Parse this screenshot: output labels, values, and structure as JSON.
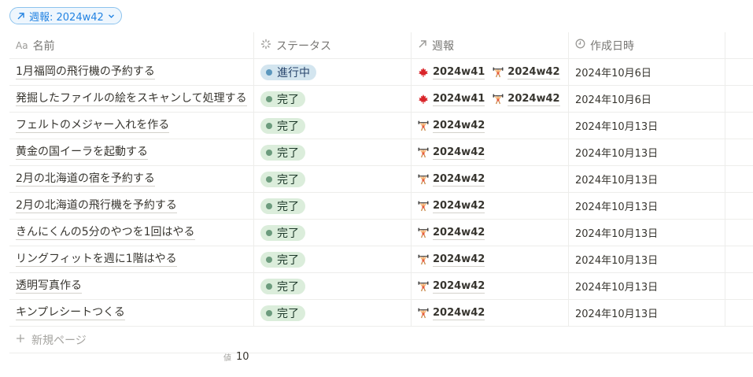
{
  "filter": {
    "label": "週報: 2024w42",
    "icon": "arrow-up-right-icon",
    "chevron": "chevron-down-icon"
  },
  "columns": [
    {
      "label": "名前",
      "icon_text": "Aa"
    },
    {
      "label": "ステータス",
      "icon": "status-loader-icon"
    },
    {
      "label": "週報",
      "icon": "arrow-up-right-icon"
    },
    {
      "label": "作成日時",
      "icon": "clock-icon"
    }
  ],
  "rows": [
    {
      "name": "1月福岡の飛行機の予約する",
      "status": "進行中",
      "status_color": "blue",
      "reports": [
        {
          "label": "2024w41",
          "icon": "maple-leaf-icon"
        },
        {
          "label": "2024w42",
          "icon": "weightlifter-icon"
        },
        {
          "label": "",
          "icon": "ship-icon"
        }
      ],
      "date": "2024年10月6日"
    },
    {
      "name": "発掘したファイルの絵をスキャンして処理する",
      "status": "完了",
      "status_color": "green",
      "reports": [
        {
          "label": "2024w41",
          "icon": "maple-leaf-icon"
        },
        {
          "label": "2024w42",
          "icon": "weightlifter-icon"
        }
      ],
      "date": "2024年10月6日"
    },
    {
      "name": "フェルトのメジャー入れを作る",
      "status": "完了",
      "status_color": "green",
      "reports": [
        {
          "label": "2024w42",
          "icon": "weightlifter-icon"
        }
      ],
      "date": "2024年10月13日"
    },
    {
      "name": "黄金の国イーラを起動する",
      "status": "完了",
      "status_color": "green",
      "reports": [
        {
          "label": "2024w42",
          "icon": "weightlifter-icon"
        }
      ],
      "date": "2024年10月13日"
    },
    {
      "name": "2月の北海道の宿を予約する",
      "status": "完了",
      "status_color": "green",
      "reports": [
        {
          "label": "2024w42",
          "icon": "weightlifter-icon"
        }
      ],
      "date": "2024年10月13日"
    },
    {
      "name": "2月の北海道の飛行機を予約する",
      "status": "完了",
      "status_color": "green",
      "reports": [
        {
          "label": "2024w42",
          "icon": "weightlifter-icon"
        }
      ],
      "date": "2024年10月13日"
    },
    {
      "name": "きんにくんの5分のやつを1回はやる",
      "status": "完了",
      "status_color": "green",
      "reports": [
        {
          "label": "2024w42",
          "icon": "weightlifter-icon"
        }
      ],
      "date": "2024年10月13日"
    },
    {
      "name": "リングフィットを週に1階はやる",
      "status": "完了",
      "status_color": "green",
      "reports": [
        {
          "label": "2024w42",
          "icon": "weightlifter-icon"
        }
      ],
      "date": "2024年10月13日"
    },
    {
      "name": "透明写真作る",
      "status": "完了",
      "status_color": "green",
      "reports": [
        {
          "label": "2024w42",
          "icon": "weightlifter-icon"
        }
      ],
      "date": "2024年10月13日"
    },
    {
      "name": "キンプレシートつくる",
      "status": "完了",
      "status_color": "green",
      "reports": [
        {
          "label": "2024w42",
          "icon": "weightlifter-icon"
        }
      ],
      "date": "2024年10月13日"
    }
  ],
  "new_page": {
    "label": "新規ページ",
    "icon": "plus-icon"
  },
  "footer": {
    "count_label": "値",
    "count_value": "10"
  },
  "colors": {
    "accent": "#2383e2",
    "status_blue_bg": "#d3e5ef",
    "status_green_bg": "#dbeddb"
  }
}
